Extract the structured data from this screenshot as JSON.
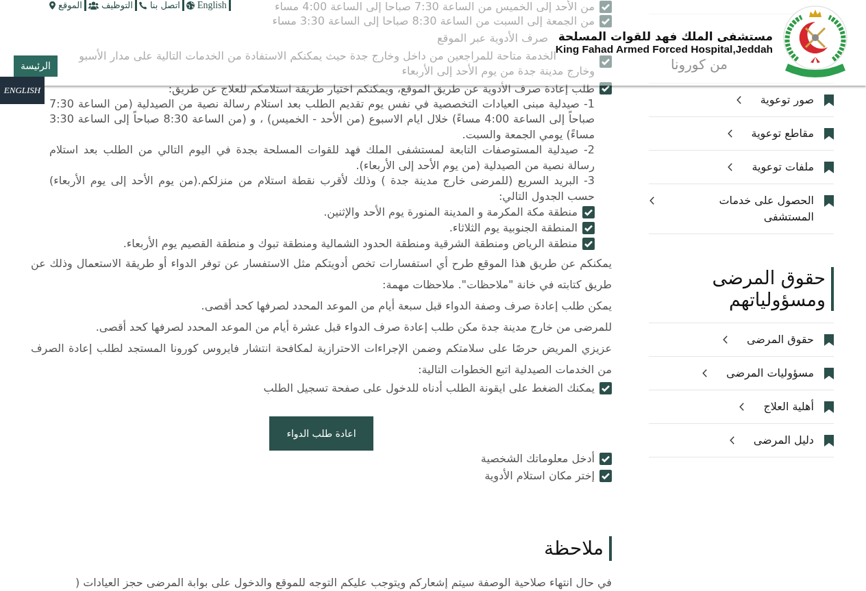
{
  "header": {
    "top_links": [
      {
        "label": "English",
        "kind": "language"
      },
      {
        "label": "اتصل بنا",
        "kind": "contact"
      },
      {
        "label": "التوظيف",
        "kind": "careers"
      },
      {
        "label": "الموقع",
        "kind": "location"
      }
    ],
    "title": "مستشفى الملك فهد للقوات المسلحة",
    "subtitle": "King Fahad Armed Forced Hospital,Jeddah",
    "home_button": "الرئيسة",
    "language_tab": "ENGLISH"
  },
  "content": {
    "blocks": [
      {
        "kind": "check",
        "text": "من الأحد إلى الخميس من الساعة 7:30 صباحا إلى الساعة 4:00 مساء"
      },
      {
        "kind": "check",
        "text": "من الجمعة إلى السبت من الساعة 8:30 صباحا إلى الساعة 3:30 مساء"
      },
      {
        "kind": "partial",
        "text": "صرف الأدوية عبر الموقع"
      },
      {
        "kind": "check",
        "children": [
          {
            "kind": "partial",
            "text": "الخدمة متاحة للمراجعين من داخل وخارج جدة حيث يمكنكم الاستفادة من الخدمات التالية على مدار الأسبو"
          },
          {
            "kind": "paragraph",
            "text": "وخارج مدينة جدة من يوم الأحد إلى الأربعاء"
          }
        ]
      },
      {
        "kind": "check",
        "text": "طلب إعادة صرف الأدوية عن طريق الموقع، ويمكنكم اختيار طريقة استلامكم للعلاج عن طريق:",
        "children": [
          {
            "kind": "paragraph",
            "text": "1- صيدلية مبنى العيادات التخصصية في نفس يوم تقديم الطلب بعد استلام رسالة نصية من الصيدلية (من الساعة 7:30 صباحاً إلى الساعة 4:00 مساءً) خلال ايام الاسبوع (من الأحد - الخميس) ، و (من الساعة 8:30 صباحاً إلى الساعة 3:30 مساءً) يومي الجمعة والسبت."
          },
          {
            "kind": "paragraph",
            "text": "2- صيدلية المستوصفات التابعة لمستشفى الملك فهد للقوات المسلحة بجدة في اليوم التالي من الطلب بعد استلام رسالة نصية من الصيدلية (من يوم الأحد إلى الأربعاء)."
          },
          {
            "kind": "paragraph",
            "text": "3- البريد السريع (للمرضى خارج مدينة جدة ) وذلك لأقرب نقطة استلام من منزلكم.(من يوم الأحد إلى يوم الأربعاء) حسب الجدول التالي:"
          },
          {
            "kind": "check",
            "text": "منطقة مكة المكرمة و المدينة المنورة يوم الأحد والإثنين."
          },
          {
            "kind": "check",
            "text": "المنطقة الجنوبية يوم الثلاثاء."
          },
          {
            "kind": "check",
            "text": "منطقة الرياض ومنطقة الشرقية ومنطقة الحدود الشمالية ومنطقة تبوك و منطقة القصيم يوم الأربعاء."
          }
        ]
      },
      {
        "kind": "paragraph",
        "text": "يمكنكم عن طريق هذا الموقع طرح أي استفسارات تخص أدويتكم مثل الاستفسار عن توفر الدواء أو طريقة الاستعمال وذلك عن طريق كتابته في خانة \"ملاحظات\". ملاحظات مهمة:"
      },
      {
        "kind": "paragraph",
        "text": "يمكن طلب إعادة صرف وصفة الدواء قبل سبعة أيام من الموعد المحدد لصرفها كحد أقصى."
      },
      {
        "kind": "paragraph",
        "text": "للمرضى من خارج مدينة جدة مكن طلب إعادة صرف الدواء قبل عشرة أيام من الموعد المحدد لصرفها كحد أقصى."
      },
      {
        "kind": "paragraph",
        "text": "عزيزي المريض حرصًا على سلامتكم وضمن الإجراءات الاحترازية لمكافحة انتشار فايروس كورونا المستجد لطلب إعادة الصرف من الخدمات الصيدلية اتبع الخطوات التالية:"
      },
      {
        "kind": "check",
        "text": "يمكنك الضغط على ايقونة الطلب أدناه للدخول على صفحة تسجيل الطلب"
      },
      {
        "kind": "button",
        "text": "اعادة طلب الدواء"
      },
      {
        "kind": "check",
        "text": "أدخل معلوماتك الشخصية"
      },
      {
        "kind": "check",
        "text": "إختر مكان استلام الأدوية"
      },
      {
        "kind": "heading",
        "text": "ملاحظة"
      },
      {
        "kind": "paragraph",
        "text": "في حال انتهاء صلاحية الوصفة سيتم إشعاركم ويتوجب عليكم التوجه للموقع والدخول على بوابة المرضى حجز العيادات ("
      }
    ]
  },
  "sidebar": {
    "sections": [
      {
        "heading": {
          "kind": "partial",
          "text": "من كورونا"
        },
        "links": [
          "صور توعوية",
          "مقاطع توعوية",
          "ملفات توعوية",
          "الحصول على خدمات المستشفى"
        ]
      },
      {
        "heading": {
          "kind": "full",
          "text": "حقوق المرضى ومسؤولياتهم"
        },
        "links": [
          "حقوق المرضى",
          "مسؤوليات المرضى",
          "أهلية العلاج",
          "دليل المرضى"
        ]
      }
    ]
  }
}
